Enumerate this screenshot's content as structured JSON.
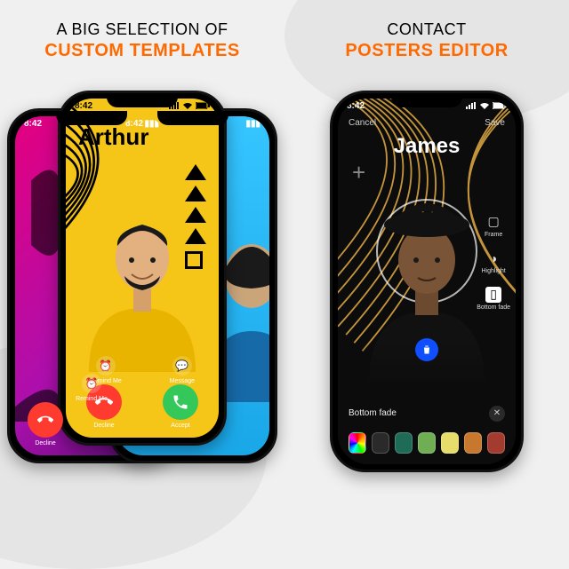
{
  "left": {
    "headline1": "A BIG SELECTION OF",
    "headline2": "CUSTOM TEMPLATES",
    "front": {
      "time": "8:42",
      "name": "Arthur",
      "remind_label": "Remind Me",
      "message_label": "Message",
      "decline_label": "Decline",
      "accept_label": "Accept"
    },
    "behind_left": {
      "time": "8:42",
      "remind_label": "Remind Me",
      "decline_label": "Decline"
    },
    "behind_right": {
      "time": "8:42"
    }
  },
  "right": {
    "headline1": "CONTACT",
    "headline2": "POSTERS EDITOR",
    "time": "8:42",
    "cancel": "Cancel",
    "save": "Save",
    "name": "James",
    "tools": {
      "frame": "Frame",
      "highlight": "Highlight",
      "bottom_fade": "Bottom fade"
    },
    "effect_label": "Bottom fade",
    "swatches": [
      "rainbow",
      "#2a2a2a",
      "#1e6b57",
      "#6fae52",
      "#e6dd6a",
      "#c7782e",
      "#a33c2f"
    ]
  }
}
